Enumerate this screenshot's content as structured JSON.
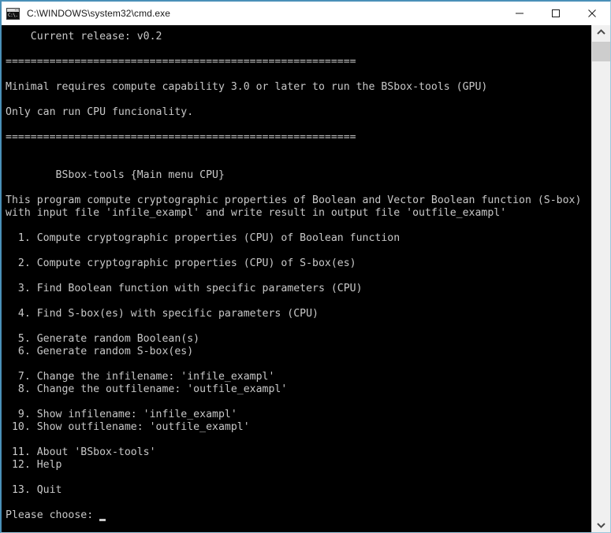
{
  "window": {
    "title": "C:\\WINDOWS\\system32\\cmd.exe",
    "icon": "cmd-console-icon",
    "icon_text": "C:\\.",
    "background": "#000000",
    "titlebar_background": "#ffffff",
    "border_color": "#4a90b8",
    "text_color": "#c8c8c8"
  },
  "controls": {
    "minimize_label": "Minimize",
    "maximize_label": "Maximize",
    "close_label": "Close"
  },
  "scrollbar": {
    "up_arrow_label": "Scroll up",
    "down_arrow_label": "Scroll down",
    "thumb_label": "Scroll thumb"
  },
  "console": {
    "release_line": "    Current release: v0.2",
    "separator": "========================================================",
    "gpu_requirement_line": "Minimal requires compute capability 3.0 or later to run the BSbox-tools (GPU)",
    "cpu_only_line": "Only can run CPU funcionality.",
    "menu_header": "        BSbox-tools {Main menu CPU}",
    "description_line_1": "This program compute cryptographic properties of Boolean and Vector Boolean function (S-box)",
    "description_line_2": "with input file 'infile_exampl' and write result in output file 'outfile_exampl'",
    "menu_items": [
      "  1. Compute cryptographic properties (CPU) of Boolean function",
      "  2. Compute cryptographic properties (CPU) of S-box(es)",
      "  3. Find Boolean function with specific parameters (CPU)",
      "  4. Find S-box(es) with specific parameters (CPU)",
      "  5. Generate random Boolean(s)",
      "  6. Generate random S-box(es)",
      "  7. Change the infilename: 'infile_exampl'",
      "  8. Change the outfilename: 'outfile_exampl'",
      "  9. Show infilename: 'infile_exampl'",
      " 10. Show outfilename: 'outfile_exampl'",
      " 11. About 'BSbox-tools'",
      " 12. Help",
      " 13. Quit"
    ],
    "prompt": "Please choose: ",
    "full_text": "    Current release: v0.2\n\n========================================================\n\nMinimal requires compute capability 3.0 or later to run the BSbox-tools (GPU)\n\nOnly can run CPU funcionality.\n\n========================================================\n\n\n        BSbox-tools {Main menu CPU}\n\nThis program compute cryptographic properties of Boolean and Vector Boolean function (S-box)\nwith input file 'infile_exampl' and write result in output file 'outfile_exampl'\n\n  1. Compute cryptographic properties (CPU) of Boolean function\n\n  2. Compute cryptographic properties (CPU) of S-box(es)\n\n  3. Find Boolean function with specific parameters (CPU)\n\n  4. Find S-box(es) with specific parameters (CPU)\n\n  5. Generate random Boolean(s)\n  6. Generate random S-box(es)\n\n  7. Change the infilename: 'infile_exampl'\n  8. Change the outfilename: 'outfile_exampl'\n\n  9. Show infilename: 'infile_exampl'\n 10. Show outfilename: 'outfile_exampl'\n\n 11. About 'BSbox-tools'\n 12. Help\n\n 13. Quit\n\nPlease choose: "
  }
}
